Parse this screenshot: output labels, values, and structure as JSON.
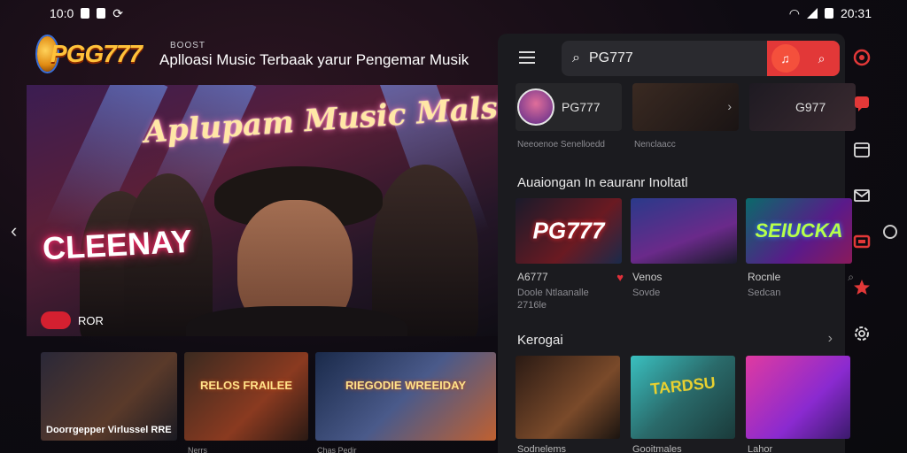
{
  "status_bar": {
    "time_left": "10:0",
    "time_right": "20:31"
  },
  "header": {
    "logo_text": "PGG777",
    "small_label": "BOOST",
    "tagline": "Aplloasi Music Terbaak yarur Pengemar Musik"
  },
  "hero": {
    "title": "Aplupam Music Malsiek",
    "neon_sign": "CLEENAY",
    "badge_label": "ROR"
  },
  "left_thumbs": [
    {
      "sign": "",
      "caption": "Doorrgepper Virlussel RRE"
    },
    {
      "sign": "RELOS FRAILEE",
      "caption": ""
    },
    {
      "sign": "RIEGODIE WREEIDAY",
      "caption": ""
    }
  ],
  "left_below": [
    "Nerrs",
    "Chas Pedir"
  ],
  "search": {
    "value": "PG777"
  },
  "channels": [
    {
      "name": "PG777",
      "caption": "Neeoenoe Senelloedd"
    },
    {
      "name": "",
      "caption": "Nenclaacc"
    },
    {
      "name": "G977",
      "caption": ""
    }
  ],
  "section1": {
    "title": "Auaiongan In eauranr Inoltatl",
    "cards": [
      {
        "title": "PG777",
        "name": "A6777",
        "sub": "Doole Ntlaanalle\n2716le"
      },
      {
        "title": "",
        "name": "Venos",
        "sub": "Sovde"
      },
      {
        "title": "SEIUCKA",
        "name": "Rocnle",
        "sub": "Sedcan"
      }
    ]
  },
  "section2": {
    "title": "Kerogai",
    "cards": [
      {
        "sign": "",
        "caption": "Sodnelems"
      },
      {
        "sign": "TARDSU",
        "caption": "Gooitmales"
      },
      {
        "sign": "",
        "caption": "Lahor"
      }
    ]
  },
  "colors": {
    "accent": "#e23838",
    "panel": "#1b1b1f",
    "background": "#0c0c10"
  }
}
